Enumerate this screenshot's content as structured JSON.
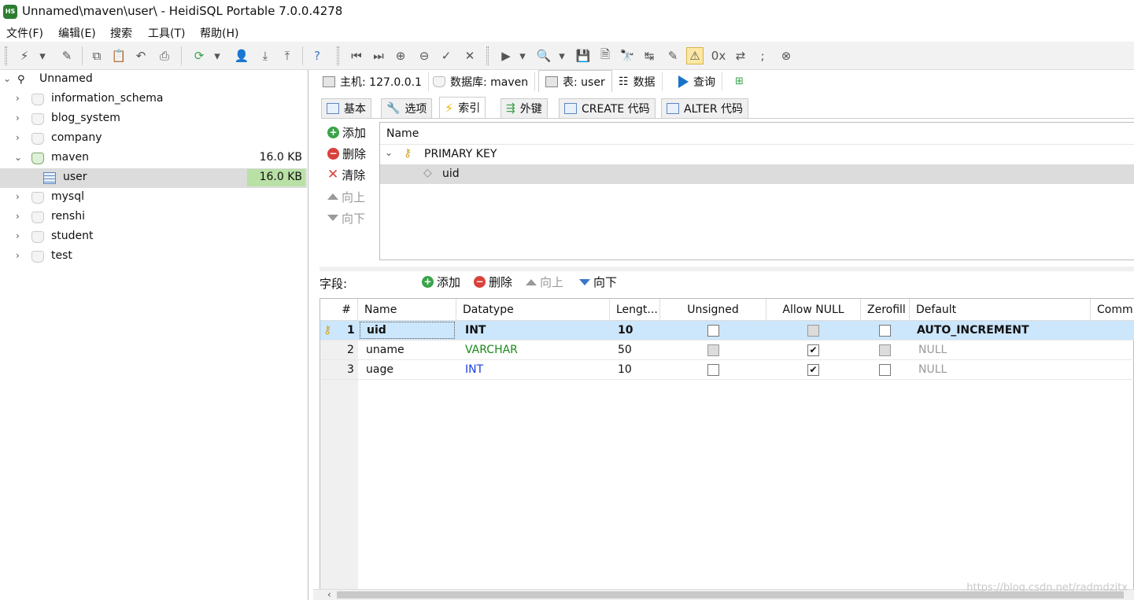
{
  "window": {
    "title": "Unnamed\\maven\\user\\ - HeidiSQL Portable 7.0.0.4278",
    "app_badge": "HS"
  },
  "menu": [
    "文件(F)",
    "编辑(E)",
    "搜索",
    "工具(T)",
    "帮助(H)"
  ],
  "tree": {
    "root": "Unnamed",
    "items": [
      {
        "label": "information_schema",
        "size": ""
      },
      {
        "label": "blog_system",
        "size": ""
      },
      {
        "label": "company",
        "size": ""
      },
      {
        "label": "maven",
        "size": "16.0 KB"
      },
      {
        "label": "user",
        "size": "16.0 KB"
      },
      {
        "label": "mysql",
        "size": ""
      },
      {
        "label": "renshi",
        "size": ""
      },
      {
        "label": "student",
        "size": ""
      },
      {
        "label": "test",
        "size": ""
      }
    ]
  },
  "top_tabs": [
    "主机: 127.0.0.1",
    "数据库: maven",
    "表: user",
    "数据",
    "查询"
  ],
  "sub_tabs": [
    "基本",
    "选项",
    "索引",
    "外键",
    "CREATE 代码",
    "ALTER 代码"
  ],
  "index_buttons": {
    "add": "添加",
    "delete": "删除",
    "clear": "清除",
    "up": "向上",
    "down": "向下"
  },
  "index_tree": {
    "header": "Name",
    "key": "PRIMARY KEY",
    "column": "uid"
  },
  "fields_bar": {
    "label": "字段:",
    "add": "添加",
    "delete": "删除",
    "up": "向上",
    "down": "向下"
  },
  "grid": {
    "headers": [
      "#",
      "Name",
      "Datatype",
      "Lengt...",
      "Unsigned",
      "Allow NULL",
      "Zerofill",
      "Default",
      "Comm"
    ],
    "rows": [
      {
        "num": "1",
        "name": "uid",
        "datatype": "INT",
        "length": "10",
        "unsigned": false,
        "allow_null": false,
        "zerofill": false,
        "default": "AUTO_INCREMENT"
      },
      {
        "num": "2",
        "name": "uname",
        "datatype": "VARCHAR",
        "length": "50",
        "unsigned": false,
        "allow_null": true,
        "zerofill": false,
        "default": "NULL"
      },
      {
        "num": "3",
        "name": "uage",
        "datatype": "INT",
        "length": "10",
        "unsigned": false,
        "allow_null": true,
        "zerofill": false,
        "default": "NULL"
      }
    ]
  },
  "watermark": "https://blog.csdn.net/radmdzjtx",
  "colors": {
    "selection": "#cce6fb",
    "size_highlight": "#b9e0a5",
    "varchar": "#1a8a1a",
    "int": "#1c3fe0",
    "null": "#9a9a9a"
  }
}
